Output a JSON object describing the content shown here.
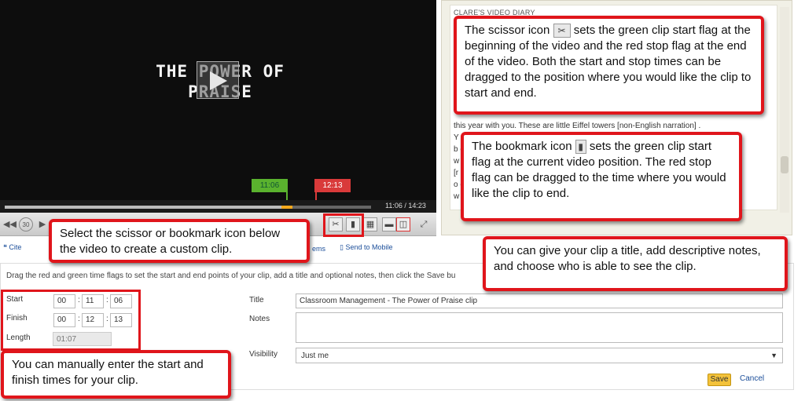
{
  "video": {
    "title": "THE POWER OF\nPRAISE",
    "flag_start_time": "11:06",
    "flag_stop_time": "12:13",
    "time_readout": "11:06 / 14:23"
  },
  "action_bar": {
    "cite_label": "Cite",
    "items_label": "ems",
    "send_to_mobile_label": "Send to Mobile"
  },
  "diary": {
    "heading": "CLARE'S VIDEO DIARY",
    "lines": [
      "",
      "s",
      "this year with you. These are little Eiffel towers [non-English narration] .",
      "Y                                                                       n the",
      "b                                                                     ece of",
      "w                                                                      you",
      "[r                                                                     n one",
      "o                                                                     ering",
      "w                                                                      table"
    ]
  },
  "form": {
    "instructions": "Drag the red and green time flags to set the start and end points of your clip, add a title and optional notes, then click the Save bu",
    "start_label": "Start",
    "finish_label": "Finish",
    "length_label": "Length",
    "start": {
      "hh": "00",
      "mm": "11",
      "ss": "06"
    },
    "finish": {
      "hh": "00",
      "mm": "12",
      "ss": "13"
    },
    "colon": ":",
    "length_value": "01:07",
    "title_label": "Title",
    "title_value": "Classroom Management - The Power of Praise clip",
    "notes_label": "Notes",
    "visibility_label": "Visibility",
    "visibility_value": "Just me",
    "save_label": "Save",
    "cancel_label": "Cancel"
  },
  "callouts": {
    "scissor_pre": "The scissor icon",
    "scissor_post": "sets the green clip start flag at the beginning of the video and the red stop flag at the end of the video. Both the start and stop times can be dragged to the position where you would like the clip to start and end.",
    "bookmark_pre": "The bookmark icon",
    "bookmark_post": "sets the green clip start flag at the current video position. The red stop flag can be dragged to the time where you would like the clip to end.",
    "select_icon": "Select the scissor or bookmark icon below the video to create a custom clip.",
    "title_notes": "You can give your clip a title, add descriptive notes, and choose who is able to see the clip.",
    "manual_times": "You can manually enter the start and finish times for your clip."
  },
  "icons": {
    "scissor": "scissors-icon",
    "bookmark": "bookmark-icon",
    "play": "play-icon"
  },
  "colors": {
    "callout_border": "#e0151b",
    "flag_start": "#5ab22e",
    "flag_stop": "#d93a3a",
    "save_button": "#f3c23a"
  }
}
